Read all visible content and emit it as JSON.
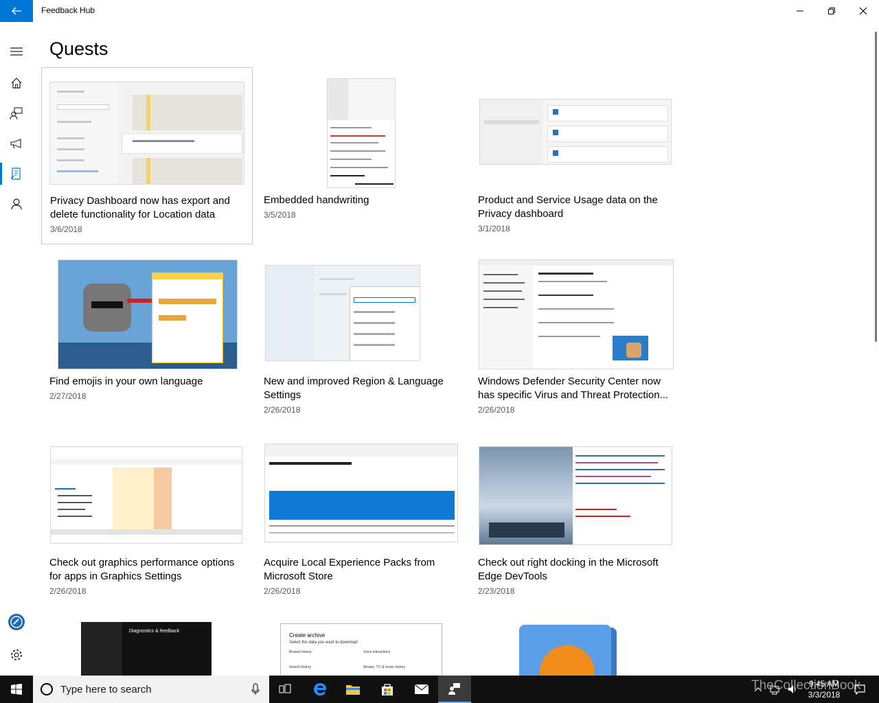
{
  "window": {
    "title": "Feedback Hub",
    "back_icon": "back-arrow-icon",
    "minimize_icon": "minimize-icon",
    "restore_icon": "restore-icon",
    "close_icon": "close-icon"
  },
  "nav": {
    "items": [
      {
        "name": "hamburger-icon"
      },
      {
        "name": "home-icon"
      },
      {
        "name": "feedback-icon"
      },
      {
        "name": "announcements-icon"
      },
      {
        "name": "quests-icon",
        "active": true
      },
      {
        "name": "profile-icon"
      },
      {
        "name": "achievements-icon"
      },
      {
        "name": "settings-icon"
      }
    ]
  },
  "page": {
    "title": "Quests"
  },
  "quests": [
    {
      "title": "Privacy Dashboard now has export and delete functionality for Location data",
      "date": "3/6/2018",
      "selected": true
    },
    {
      "title": "Embedded handwriting",
      "date": "3/5/2018"
    },
    {
      "title": "Product and Service Usage data on the Privacy dashboard",
      "date": "3/1/2018"
    },
    {
      "title": "Find emojis in your own language",
      "date": "2/27/2018"
    },
    {
      "title": "New and improved Region & Language Settings",
      "date": "2/26/2018"
    },
    {
      "title": "Windows Defender Security Center now has specific Virus and Threat Protection...",
      "date": "2/26/2018"
    },
    {
      "title": "Check out graphics performance options for apps in Graphics Settings",
      "date": "2/26/2018"
    },
    {
      "title": "Acquire Local Experience Packs from Microsoft Store",
      "date": "2/26/2018"
    },
    {
      "title": "Check out right docking in the Microsoft Edge DevTools",
      "date": "2/23/2018"
    }
  ],
  "partial_thumbs": {
    "diag_title": "Diagnostics & feedback",
    "archive_title": "Create archive",
    "archive_sub": "Select the data you want to download",
    "archive_items": [
      "Browse history",
      "Voice interactions",
      "Search history",
      "Movies, TV, & music history"
    ]
  },
  "taskbar": {
    "search_placeholder": "Type here to search",
    "time": "9:45 AM",
    "date": "3/3/2018",
    "watermark": "TheCollectionBook",
    "accent": "#0078d7"
  }
}
